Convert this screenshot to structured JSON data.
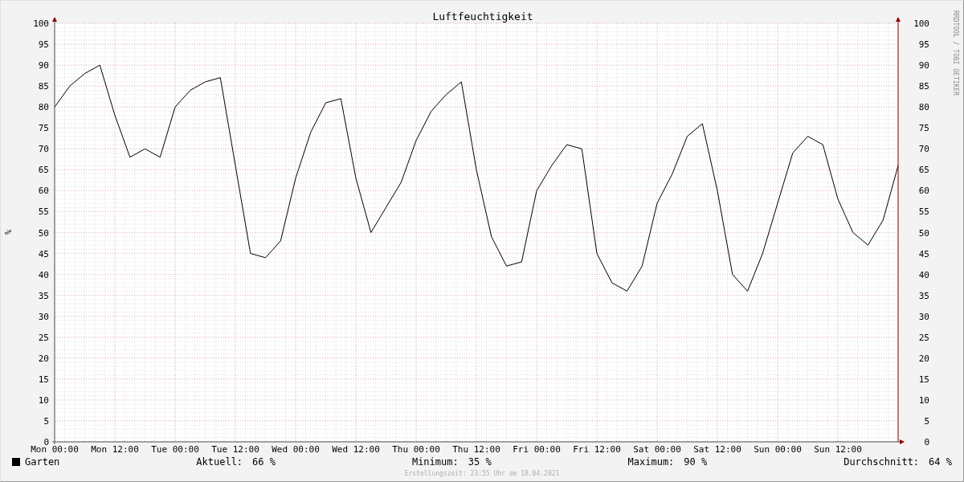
{
  "graph": {
    "watermark_text": "RRDTOOL / TOBI OETIKER",
    "right_axis_ticks": [
      "100",
      "95",
      "90",
      "85",
      "80",
      "75",
      "70",
      "65",
      "60",
      "55",
      "50",
      "45",
      "40",
      "35",
      "30",
      "25",
      "20",
      "15",
      "10",
      "5",
      "0"
    ],
    "chart_data": {
      "type": "line",
      "grid": true,
      "title": "Luftfeuchtigkeit",
      "ylabel": "%",
      "ylim": [
        0,
        100
      ],
      "categories": [
        "Mon 00:00",
        null,
        null,
        null,
        "Mon 12:00",
        null,
        null,
        null,
        "Tue 00:00",
        null,
        null,
        null,
        "Tue 12:00",
        null,
        null,
        null,
        "Wed 00:00",
        null,
        null,
        null,
        "Wed 12:00",
        null,
        null,
        null,
        "Thu 00:00",
        null,
        null,
        null,
        "Thu 12:00",
        null,
        null,
        null,
        "Fri 00:00",
        null,
        null,
        null,
        "Fri 12:00",
        null,
        null,
        null,
        "Sat 00:00",
        null,
        null,
        null,
        "Sat 12:00",
        null,
        null,
        null,
        "Sun 00:00",
        null,
        null,
        null,
        "Sun 12:00",
        null,
        null,
        null,
        null
      ],
      "yticks": [
        0,
        5,
        10,
        15,
        20,
        25,
        30,
        35,
        40,
        45,
        50,
        55,
        60,
        65,
        70,
        75,
        80,
        85,
        90,
        95,
        100
      ],
      "series": [
        {
          "name": "Garten",
          "color": "#000000",
          "values": [
            80,
            85,
            88,
            90,
            78,
            68,
            70,
            68,
            80,
            84,
            86,
            87,
            66,
            45,
            44,
            48,
            63,
            74,
            81,
            82,
            63,
            50,
            56,
            62,
            72,
            79,
            83,
            86,
            65,
            49,
            42,
            43,
            60,
            66,
            71,
            70,
            45,
            38,
            36,
            42,
            57,
            64,
            73,
            76,
            60,
            40,
            36,
            45,
            57,
            69,
            73,
            71,
            58,
            50,
            47,
            53,
            66
          ]
        }
      ]
    }
  },
  "legend": {
    "stats": [
      {
        "label": "Aktuell:",
        "value": "66 %"
      },
      {
        "label": "Minimum:",
        "value": "35 %"
      },
      {
        "label": "Maximum:",
        "value": "90 %"
      },
      {
        "label": "Durchschnitt:",
        "value": "64 %"
      }
    ]
  },
  "footer": {
    "text": "Erstellungszeit: 23:55 Uhr am 18.04.2021"
  }
}
